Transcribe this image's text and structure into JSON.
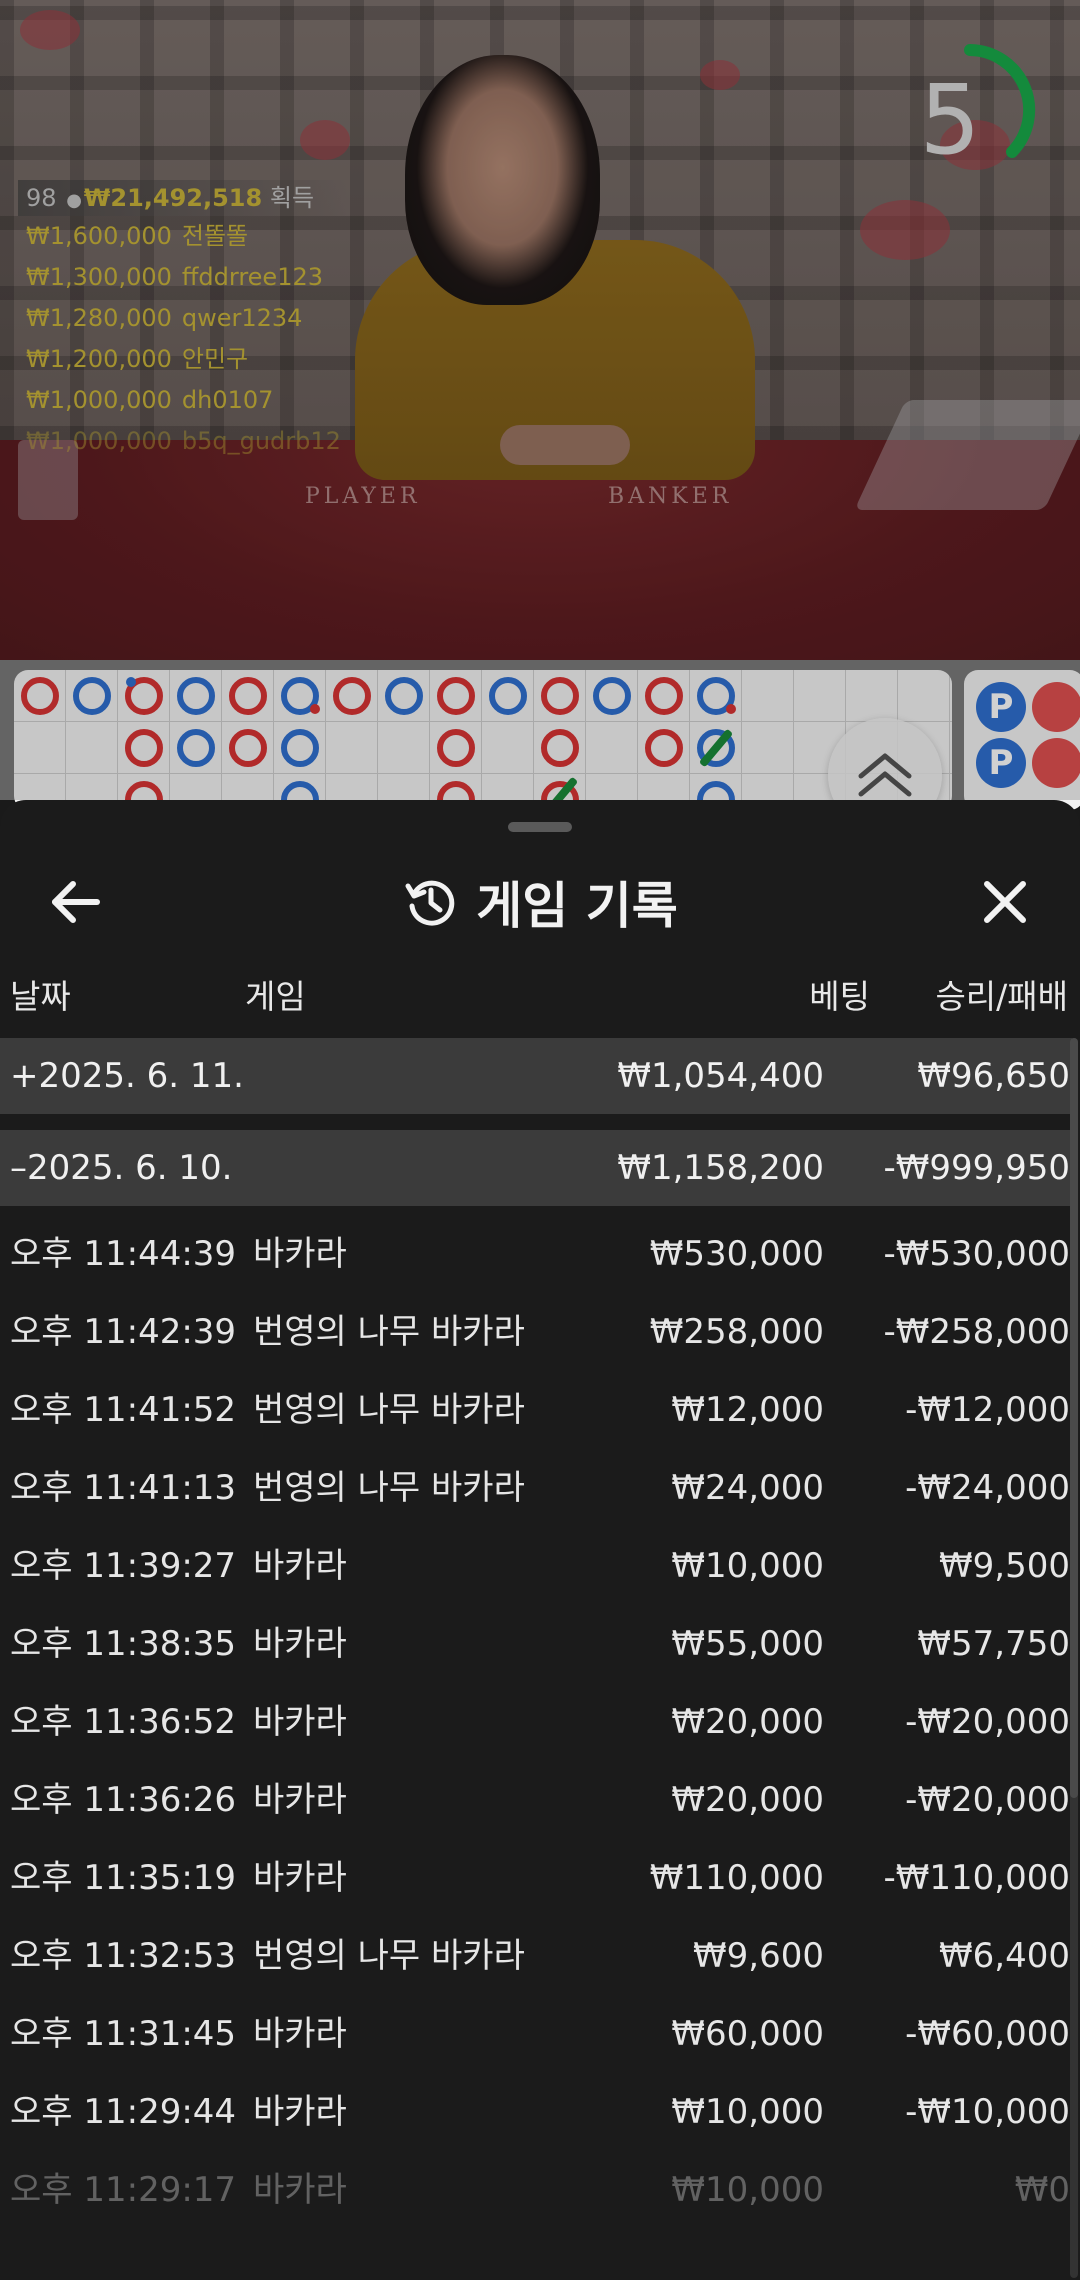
{
  "stream": {
    "countdown": "5",
    "table_labels": [
      "PLAYER",
      "BANKER"
    ],
    "winners_summary": {
      "count": "98",
      "total": "₩21,492,518",
      "suffix": "획득"
    },
    "winners": [
      {
        "amount": "₩1,600,000",
        "name": "전똘똘"
      },
      {
        "amount": "₩1,300,000",
        "name": "ffddrree123"
      },
      {
        "amount": "₩1,280,000",
        "name": "qwer1234"
      },
      {
        "amount": "₩1,200,000",
        "name": "안민구"
      },
      {
        "amount": "₩1,000,000",
        "name": "dh0107"
      },
      {
        "amount": "₩1,000,000",
        "name": "b5q_gudrb12"
      }
    ]
  },
  "roadmap": {
    "bead_plate_labels": [
      "P",
      "P"
    ]
  },
  "history": {
    "title": "게임 기록",
    "columns": {
      "date": "날짜",
      "game": "게임",
      "bet": "베팅",
      "win_loss": "승리/패배"
    },
    "days": [
      {
        "toggle": "+",
        "date": "2025. 6. 11.",
        "bet": "₩1,054,400",
        "win_loss": "₩96,650",
        "expanded": false
      },
      {
        "toggle": "–",
        "date": "2025. 6. 10.",
        "bet": "₩1,158,200",
        "win_loss": "-₩999,950",
        "expanded": true
      }
    ],
    "rows": [
      {
        "time": "오후 11:44:39",
        "game": "바카라",
        "bet": "₩530,000",
        "win_loss": "-₩530,000"
      },
      {
        "time": "오후 11:42:39",
        "game": "번영의 나무 바카라",
        "bet": "₩258,000",
        "win_loss": "-₩258,000"
      },
      {
        "time": "오후 11:41:52",
        "game": "번영의 나무 바카라",
        "bet": "₩12,000",
        "win_loss": "-₩12,000"
      },
      {
        "time": "오후 11:41:13",
        "game": "번영의 나무 바카라",
        "bet": "₩24,000",
        "win_loss": "-₩24,000"
      },
      {
        "time": "오후 11:39:27",
        "game": "바카라",
        "bet": "₩10,000",
        "win_loss": "₩9,500"
      },
      {
        "time": "오후 11:38:35",
        "game": "바카라",
        "bet": "₩55,000",
        "win_loss": "₩57,750"
      },
      {
        "time": "오후 11:36:52",
        "game": "바카라",
        "bet": "₩20,000",
        "win_loss": "-₩20,000"
      },
      {
        "time": "오후 11:36:26",
        "game": "바카라",
        "bet": "₩20,000",
        "win_loss": "-₩20,000"
      },
      {
        "time": "오후 11:35:19",
        "game": "바카라",
        "bet": "₩110,000",
        "win_loss": "-₩110,000"
      },
      {
        "time": "오후 11:32:53",
        "game": "번영의 나무 바카라",
        "bet": "₩9,600",
        "win_loss": "₩6,400"
      },
      {
        "time": "오후 11:31:45",
        "game": "바카라",
        "bet": "₩60,000",
        "win_loss": "-₩60,000"
      },
      {
        "time": "오후 11:29:44",
        "game": "바카라",
        "bet": "₩10,000",
        "win_loss": "-₩10,000"
      },
      {
        "time": "오후 11:29:17",
        "game": "바카라",
        "bet": "₩10,000",
        "win_loss": "₩0"
      }
    ]
  },
  "icons": {
    "back": "arrow-left-icon",
    "history": "history-clock-icon",
    "close": "close-icon",
    "scroll_up": "double-chevron-up-icon"
  },
  "colors": {
    "banker": "#d83434",
    "player": "#2f6fd0",
    "tie": "#1a8a3a",
    "gold_text": "#c8b23a",
    "timer_ring": "#19a94a"
  }
}
